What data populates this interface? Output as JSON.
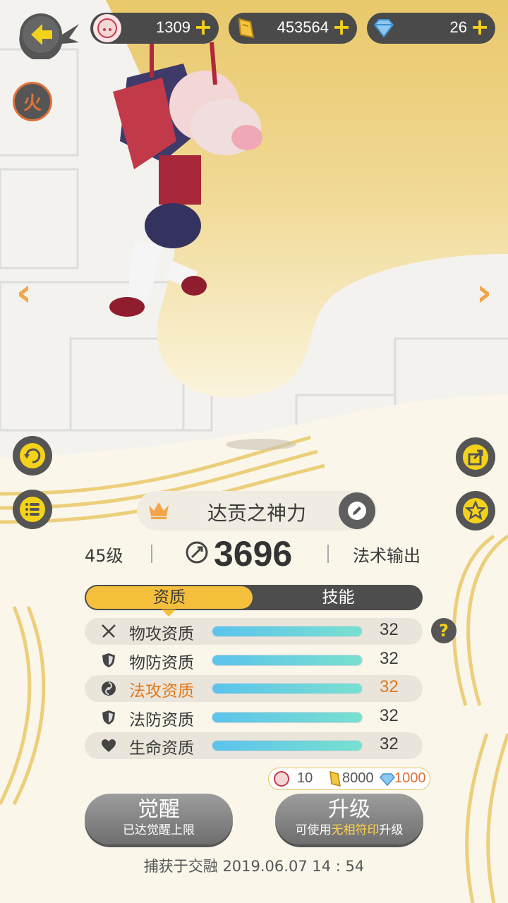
{
  "currencies": [
    {
      "name": "spirit-avatar",
      "value": "1309",
      "add": "+"
    },
    {
      "name": "gold-ingot",
      "value": "453564",
      "add": "+"
    },
    {
      "name": "diamond",
      "value": "26",
      "add": "+"
    }
  ],
  "side_buttons": {
    "fire_label": "火",
    "prev": "‹",
    "next": "›"
  },
  "character": {
    "name": "达贡之神力",
    "level": "45级",
    "power": "3696",
    "role": "法术输出"
  },
  "tabs": {
    "active": "资质",
    "inactive": "技能"
  },
  "stats": [
    {
      "label": "物攻资质",
      "value": "32",
      "fill": 1.0,
      "icon": "swords-icon",
      "highlight": false
    },
    {
      "label": "物防资质",
      "value": "32",
      "fill": 1.0,
      "icon": "shield-icon",
      "highlight": false
    },
    {
      "label": "法攻资质",
      "value": "32",
      "fill": 1.0,
      "icon": "magic-orb-icon",
      "highlight": true
    },
    {
      "label": "法防资质",
      "value": "32",
      "fill": 1.0,
      "icon": "shield-icon",
      "highlight": false
    },
    {
      "label": "生命资质",
      "value": "32",
      "fill": 1.0,
      "icon": "heart-icon",
      "highlight": false
    }
  ],
  "help": "?",
  "cost": {
    "avatar": "10",
    "gold": "8000",
    "diamond": "1000"
  },
  "awaken": {
    "title": "觉醒",
    "sub": "已达觉醒上限"
  },
  "upgrade": {
    "title": "升级",
    "sub_pre": "可使用",
    "sub_hl": "无相符印",
    "sub_post": "升级"
  },
  "footer": "捕获于交融  2019.06.07   14 : 54",
  "colors": {
    "accent": "#f4bf3b",
    "highlight": "#e07a1a",
    "dark": "#4d4d4d"
  }
}
